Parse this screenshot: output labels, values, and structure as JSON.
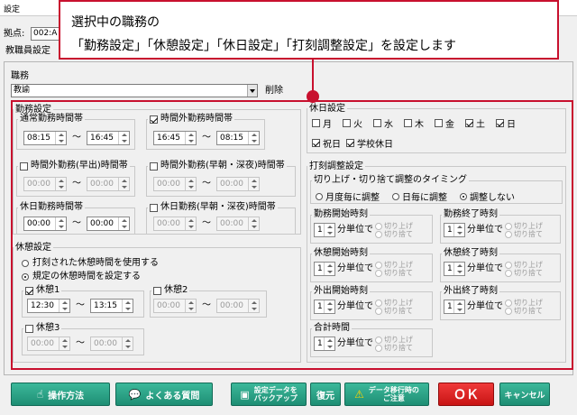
{
  "window": {
    "title": "設定"
  },
  "topbar": {
    "location_label": "拠点:",
    "location_value": "002:A"
  },
  "tab": {
    "label": "教職員設定"
  },
  "callout": {
    "line1": "選択中の職務の",
    "line2": "「勤務設定」「休憩設定」「休日設定」「打刻調整設定」を設定します"
  },
  "job": {
    "title": "職務",
    "selected": "教諭",
    "delete_label": "削除"
  },
  "kinmu": {
    "title": "勤務設定",
    "regular": {
      "label": "通常勤務時間帯",
      "from": "08:15",
      "to": "16:45"
    },
    "overtime": {
      "label": "時間外勤務時間帯",
      "checked": true,
      "from": "16:45",
      "to": "08:15"
    },
    "early": {
      "label": "時間外勤務(早出)時間帯",
      "checked": false,
      "from": "00:00",
      "to": "00:00"
    },
    "early_night": {
      "label": "時間外勤務(早朝・深夜)時間帯",
      "checked": false,
      "from": "00:00",
      "to": "00:00"
    },
    "holiday": {
      "label": "休日勤務時間帯",
      "from": "00:00",
      "to": "00:00"
    },
    "holiday_night": {
      "label": "休日勤務(早朝・深夜)時間帯",
      "checked": false,
      "from": "00:00",
      "to": "00:00"
    },
    "tilde": "〜"
  },
  "kyukei": {
    "title": "休憩設定",
    "opt1": "打刻された休憩時間を使用する",
    "opt2": "規定の休憩時間を設定する",
    "break1": {
      "label": "休憩1",
      "checked": true,
      "from": "12:30",
      "to": "13:15"
    },
    "break2": {
      "label": "休憩2",
      "checked": false,
      "from": "00:00",
      "to": "00:00"
    },
    "break3": {
      "label": "休憩3",
      "checked": false,
      "from": "00:00",
      "to": "00:00"
    }
  },
  "kyujitsu": {
    "title": "休日設定",
    "days": [
      {
        "label": "月",
        "checked": false
      },
      {
        "label": "火",
        "checked": false
      },
      {
        "label": "水",
        "checked": false
      },
      {
        "label": "木",
        "checked": false
      },
      {
        "label": "金",
        "checked": false
      },
      {
        "label": "土",
        "checked": true
      },
      {
        "label": "日",
        "checked": true
      }
    ],
    "extra": [
      {
        "label": "祝日",
        "checked": true
      },
      {
        "label": "学校休日",
        "checked": true
      }
    ]
  },
  "dakoku": {
    "title": "打刻調整設定",
    "timing_title": "切り上げ・切り捨て調整のタイミング",
    "timing_opts": [
      "月度毎に調整",
      "日毎に調整",
      "調整しない"
    ],
    "timing_selected": 2,
    "unit_label": "分単位で",
    "round_up": "切り上げ",
    "round_down": "切り捨て",
    "items": [
      {
        "label": "勤務開始時刻",
        "value": "1"
      },
      {
        "label": "勤務終了時刻",
        "value": "1"
      },
      {
        "label": "休憩開始時刻",
        "value": "1"
      },
      {
        "label": "休憩終了時刻",
        "value": "1"
      },
      {
        "label": "外出開始時刻",
        "value": "1"
      },
      {
        "label": "外出終了時刻",
        "value": "1"
      },
      {
        "label": "合計時間",
        "value": "1"
      }
    ]
  },
  "buttons": {
    "howto": "操作方法",
    "faq": "よくある質問",
    "backup_1": "設定データを",
    "backup_2": "バックアップ",
    "restore": "復元",
    "migrate_1": "データ移行時の",
    "migrate_2": "ご注意",
    "ok": "ＯＫ",
    "cancel": "キャンセル"
  },
  "colors": {
    "accent": "#1e8e74",
    "ok": "#d21a1a",
    "highlight": "#c8102e"
  }
}
